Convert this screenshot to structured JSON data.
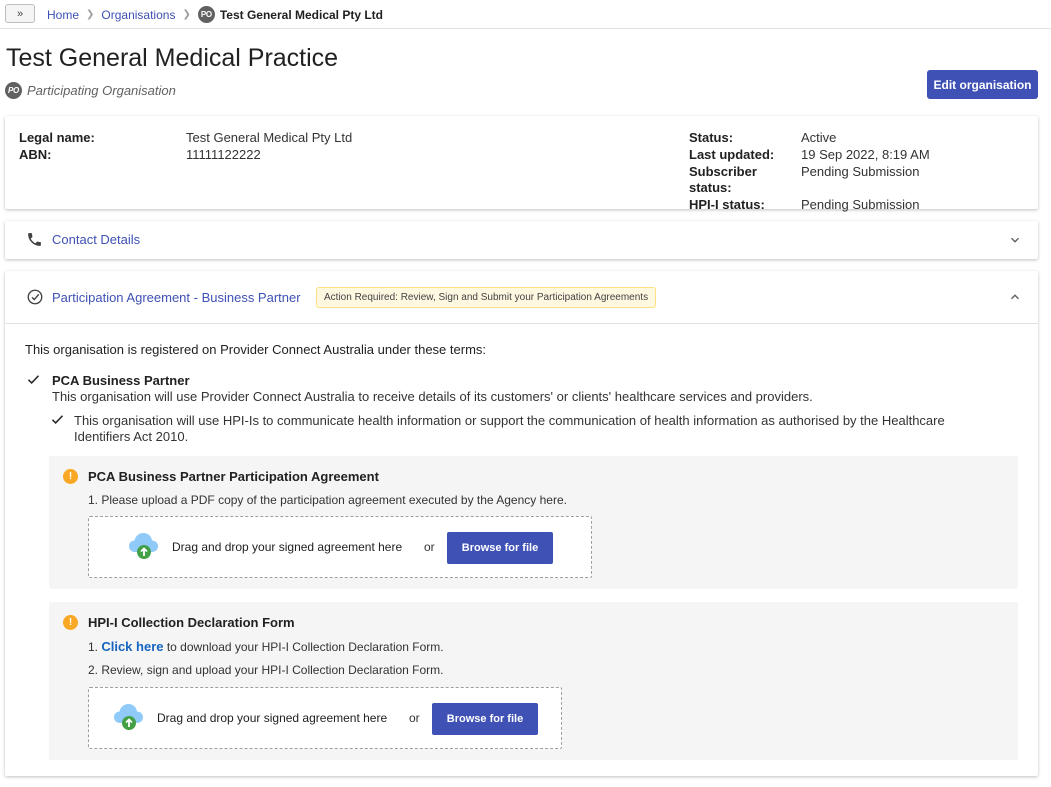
{
  "breadcrumb": {
    "expand_label": "»",
    "home": "Home",
    "organisations": "Organisations",
    "current_badge": "PO",
    "current": "Test General Medical Pty Ltd"
  },
  "header": {
    "title": "Test General Medical Practice",
    "badge": "PO",
    "subtitle": "Participating Organisation",
    "edit_button": "Edit organisation"
  },
  "info": {
    "legal_name_label": "Legal name:",
    "legal_name": "Test General Medical Pty Ltd",
    "abn_label": "ABN:",
    "abn": "11111122222",
    "status_label": "Status:",
    "status": "Active",
    "last_updated_label": "Last updated:",
    "last_updated": "19 Sep 2022, 8:19 AM",
    "subscriber_status_label": "Subscriber status:",
    "subscriber_status": "Pending Submission",
    "hpii_status_label": "HPI-I status:",
    "hpii_status": "Pending Submission"
  },
  "contact": {
    "title": "Contact Details",
    "icon": "phone-icon"
  },
  "agreement": {
    "title": "Participation Agreement - Business Partner",
    "icon": "check-circle-icon",
    "action_badge": "Action Required: Review, Sign and Submit your Participation Agreements",
    "intro": "This organisation is registered on Provider Connect Australia under these terms:",
    "pca_title": "PCA Business Partner",
    "pca_desc": "This organisation will use Provider Connect Australia to receive details of its customers' or clients' healthcare services and providers.",
    "hpi_text": "This organisation will use HPI-Is to communicate health information or support the communication of health information as authorised by the Healthcare Identifiers Act 2010.",
    "panel1": {
      "title": "PCA Business Partner Participation Agreement",
      "line1": "1. Please upload a PDF copy of the participation agreement executed by the Agency here.",
      "drop_text": "Drag and drop your signed agreement here",
      "or": "or",
      "browse": "Browse for file"
    },
    "panel2": {
      "title": "HPI-I Collection Declaration Form",
      "line1_prefix": "1. ",
      "line1_link": "Click here",
      "line1_suffix": " to download your HPI-I Collection Declaration Form.",
      "line2": "2. Review, sign and upload your HPI-I Collection Declaration Form.",
      "drop_text": "Drag and drop your signed agreement here",
      "or": "or",
      "browse": "Browse for file"
    }
  },
  "colors": {
    "primary": "#3f51b5",
    "warning": "#f9a825",
    "badge_bg": "#fff8e1"
  }
}
